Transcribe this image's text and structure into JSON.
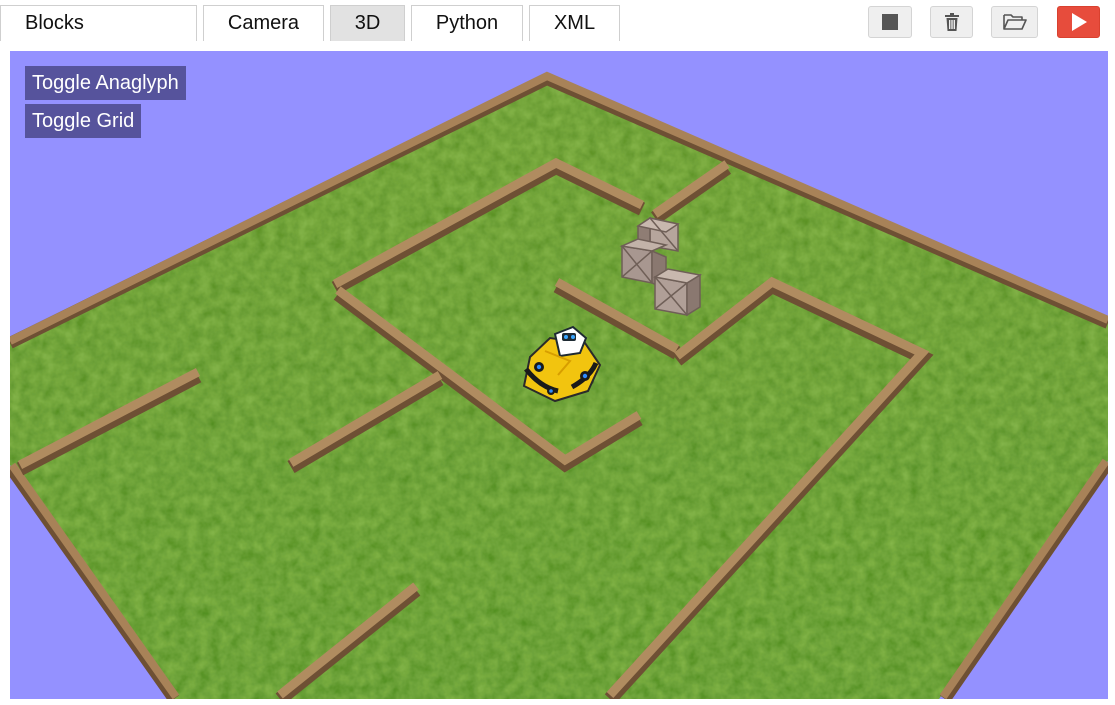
{
  "tabs": [
    {
      "label": "Blocks",
      "active": false
    },
    {
      "label": "Camera",
      "active": false
    },
    {
      "label": "3D",
      "active": true
    },
    {
      "label": "Python",
      "active": false
    },
    {
      "label": "XML",
      "active": false
    }
  ],
  "toolbar": {
    "buttons": [
      {
        "icon": "stop-icon"
      },
      {
        "icon": "trash-icon"
      },
      {
        "icon": "folder-open-icon"
      },
      {
        "icon": "play-icon"
      }
    ],
    "run_color": "#e74c3c"
  },
  "viewport": {
    "sky_color": "#9491ff",
    "grass_color": "#4f8a1f",
    "wall_color": "#a07b55",
    "overlay_buttons": [
      {
        "label": "Toggle Anaglyph"
      },
      {
        "label": "Toggle Grid"
      }
    ]
  }
}
